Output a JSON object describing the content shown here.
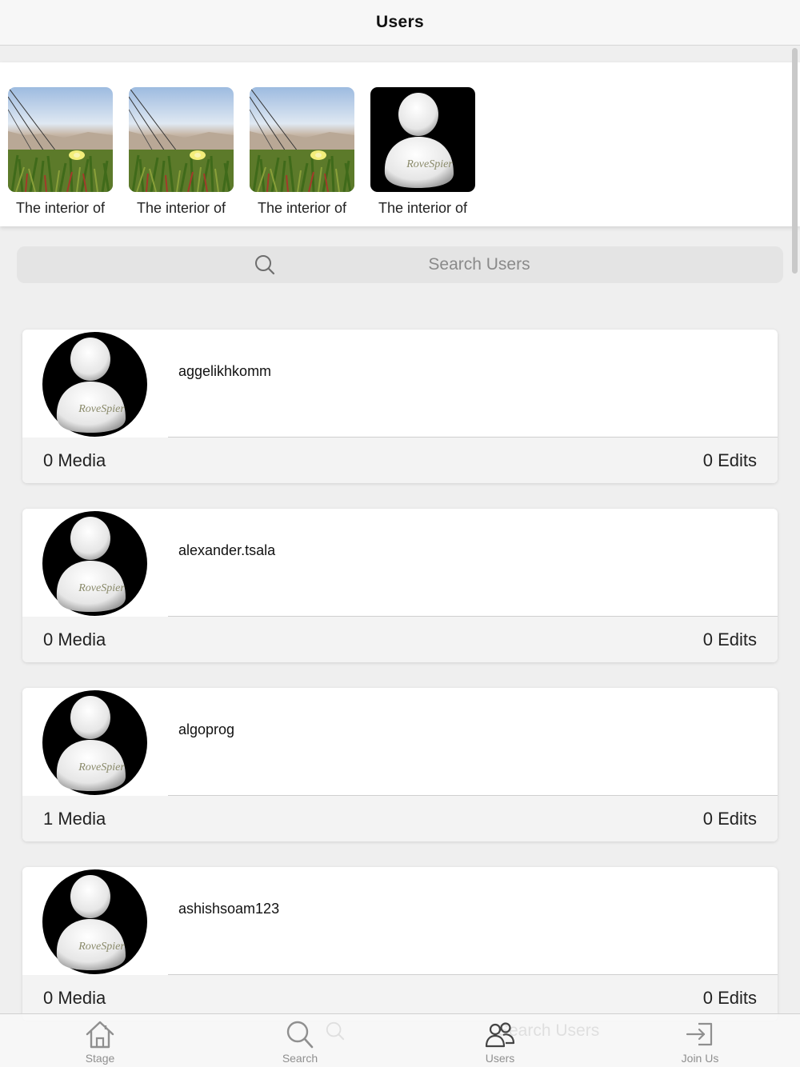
{
  "header": {
    "title": "Users"
  },
  "featured": [
    {
      "label": "The interior of",
      "image": "landscape-photo"
    },
    {
      "label": "The interior of",
      "image": "landscape-photo"
    },
    {
      "label": "The interior of",
      "image": "landscape-photo"
    },
    {
      "label": "The interior of",
      "image": "default-avatar"
    }
  ],
  "avatar_watermark": "RoveSpier",
  "search": {
    "placeholder": "Search Users"
  },
  "users": [
    {
      "name": "aggelikhkomm",
      "media": "0 Media",
      "edits": "0 Edits"
    },
    {
      "name": "alexander.tsala",
      "media": "0 Media",
      "edits": "0 Edits"
    },
    {
      "name": "algoprog",
      "media": "1 Media",
      "edits": "0 Edits"
    },
    {
      "name": "ashishsoam123",
      "media": "0 Media",
      "edits": "0 Edits"
    }
  ],
  "tabs": [
    {
      "label": "Stage",
      "icon": "home-icon"
    },
    {
      "label": "Search",
      "icon": "search-icon"
    },
    {
      "label": "Users",
      "icon": "users-icon"
    },
    {
      "label": "Join Us",
      "icon": "sign-in-icon"
    }
  ],
  "colors": {
    "background": "#efefef",
    "card": "#ffffff",
    "footer": "#f3f3f3",
    "tab_label": "#8f8f8f"
  }
}
